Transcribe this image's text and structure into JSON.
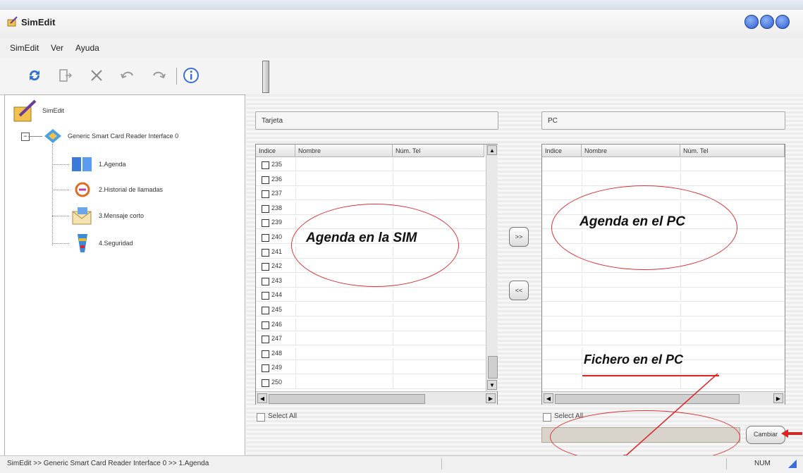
{
  "window": {
    "title": "SimEdit"
  },
  "menu": [
    "SimEdit",
    "Ver",
    "Ayuda"
  ],
  "toolbar": {
    "icons": [
      "refresh-icon",
      "export-icon",
      "delete-icon",
      "undo-icon",
      "redo-icon",
      "info-icon"
    ]
  },
  "tree": {
    "root": "SimEdit",
    "reader": "Generic Smart Card Reader Interface 0",
    "items": [
      "1.Agenda",
      "2.Historial de llamadas",
      "3.Mensaje corto",
      "4.Seguridad"
    ]
  },
  "sim_panel": {
    "group_label": "Tarjeta",
    "columns": [
      "Indice",
      "Nombre",
      "Núm. Tel"
    ],
    "rows": [
      "235",
      "236",
      "237",
      "238",
      "239",
      "240",
      "241",
      "242",
      "243",
      "244",
      "245",
      "246",
      "247",
      "248",
      "249",
      "250"
    ],
    "select_all": "Select All",
    "annotation": "Agenda en la SIM"
  },
  "pc_panel": {
    "group_label": "PC",
    "columns": [
      "Indice",
      "Nombre",
      "Núm. Tel"
    ],
    "select_all": "Select All",
    "annotation": "Agenda en el PC",
    "file_annotation": "Fichero en el PC",
    "button": "Cambiar"
  },
  "transfer": {
    "to_pc": ">>",
    "to_sim": "<<"
  },
  "status": {
    "path": "SimEdit >> Generic Smart Card Reader Interface 0 >> 1.Agenda",
    "num": "NUM"
  },
  "colors": {
    "annotation_red": "#dd2222",
    "title_button_blue": "#2b5bd3"
  }
}
